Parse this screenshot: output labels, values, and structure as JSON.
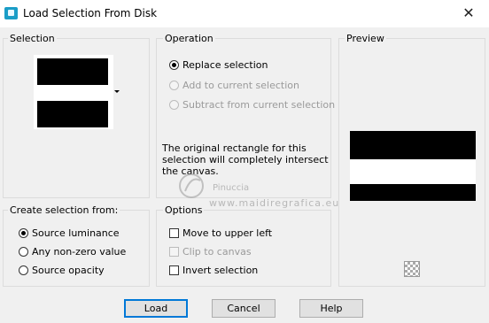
{
  "window": {
    "title": "Load Selection From Disk",
    "close_glyph": "✕"
  },
  "selection": {
    "label": "Selection"
  },
  "operation": {
    "label": "Operation",
    "options": [
      {
        "label": "Replace selection",
        "checked": true,
        "enabled": true
      },
      {
        "label": "Add to current selection",
        "checked": false,
        "enabled": false
      },
      {
        "label": "Subtract from current selection",
        "checked": false,
        "enabled": false
      }
    ],
    "info_text": "The original rectangle for this selection will completely intersect the canvas."
  },
  "preview": {
    "label": "Preview"
  },
  "create_from": {
    "label": "Create selection from:",
    "options": [
      {
        "label": "Source luminance",
        "checked": true
      },
      {
        "label": "Any non-zero value",
        "checked": false
      },
      {
        "label": "Source opacity",
        "checked": false
      }
    ]
  },
  "options": {
    "label": "Options",
    "items": [
      {
        "label": "Move to upper left",
        "checked": false,
        "enabled": true
      },
      {
        "label": "Clip to canvas",
        "checked": false,
        "enabled": false
      },
      {
        "label": "Invert selection",
        "checked": false,
        "enabled": true
      }
    ]
  },
  "buttons": {
    "load": "Load",
    "cancel": "Cancel",
    "help": "Help"
  },
  "watermark": {
    "line1": "Pinuccia",
    "line2": "www.maidiregrafica.eu"
  },
  "colors": {
    "accent": "#0078d7",
    "app_icon": "#1a9dc7"
  }
}
